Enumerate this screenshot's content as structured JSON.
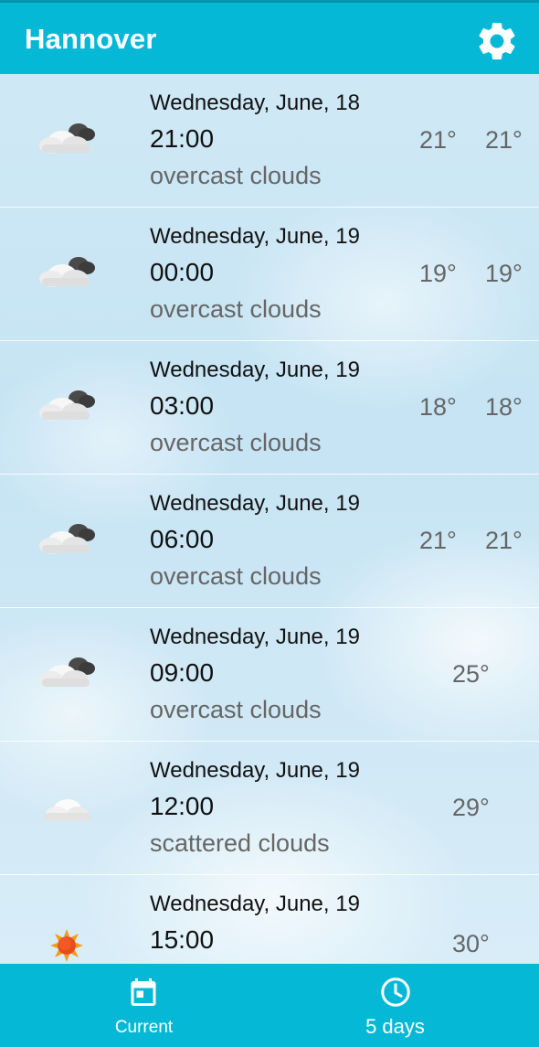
{
  "header": {
    "city": "Hannover"
  },
  "forecast": [
    {
      "date": "Wednesday, June, 18",
      "time": "21:00",
      "description": "overcast clouds",
      "temp_min": "21°",
      "temp_max": "21°",
      "icon": "overcast-clouds-icon"
    },
    {
      "date": "Wednesday, June, 19",
      "time": "00:00",
      "description": "overcast clouds",
      "temp_min": "19°",
      "temp_max": "19°",
      "icon": "overcast-clouds-icon"
    },
    {
      "date": "Wednesday, June, 19",
      "time": "03:00",
      "description": "overcast clouds",
      "temp_min": "18°",
      "temp_max": "18°",
      "icon": "overcast-clouds-icon"
    },
    {
      "date": "Wednesday, June, 19",
      "time": "06:00",
      "description": "overcast clouds",
      "temp_min": "21°",
      "temp_max": "21°",
      "icon": "overcast-clouds-icon"
    },
    {
      "date": "Wednesday, June, 19",
      "time": "09:00",
      "description": "overcast clouds",
      "temp": "25°",
      "icon": "overcast-clouds-icon"
    },
    {
      "date": "Wednesday, June, 19",
      "time": "12:00",
      "description": "scattered clouds",
      "temp": "29°",
      "icon": "scattered-clouds-icon"
    },
    {
      "date": "Wednesday, June, 19",
      "time": "15:00",
      "description": "",
      "temp": "30°",
      "icon": "sun-icon"
    }
  ],
  "bottom_nav": {
    "current_label": "Current",
    "five_days_label": "5 days"
  },
  "colors": {
    "accent": "#05b9d6"
  }
}
